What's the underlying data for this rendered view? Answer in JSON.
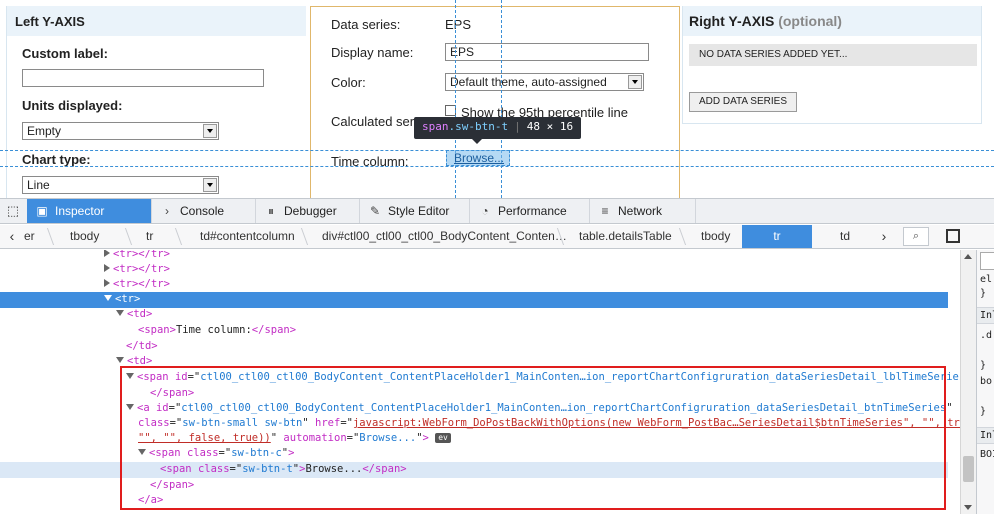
{
  "left_panel": {
    "title": "Left Y-AXIS",
    "custom_label": "Custom label:",
    "custom_label_value": "",
    "units_label": "Units displayed:",
    "units_value": "Empty",
    "chart_type_label": "Chart type:",
    "chart_type_value": "Line"
  },
  "mid_panel": {
    "data_series_label": "Data series:",
    "data_series_value": "EPS",
    "display_name_label": "Display name:",
    "display_name_value": "EPS",
    "color_label": "Color:",
    "color_value": "Default theme, auto-assigned",
    "calculated_label": "Calculated ser",
    "percentile_label": "Show the 95th percentile line",
    "time_column_label": "Time column:",
    "browse_label": "Browse..."
  },
  "right_panel": {
    "title": "Right Y-AXIS",
    "optional": "(optional)",
    "no_data": "NO DATA SERIES ADDED YET...",
    "add_button": "ADD DATA SERIES"
  },
  "tooltip": {
    "tag": "span",
    "class": ".sw-btn-t",
    "size": "48 × 16"
  },
  "devtools": {
    "tabs": [
      {
        "label": "Inspector",
        "icon": "inspector-icon"
      },
      {
        "label": "Console",
        "icon": "console-icon"
      },
      {
        "label": "Debugger",
        "icon": "debugger-icon"
      },
      {
        "label": "Style Editor",
        "icon": "style-editor-icon"
      },
      {
        "label": "Performance",
        "icon": "performance-icon"
      },
      {
        "label": "Network",
        "icon": "network-icon"
      }
    ],
    "breadcrumbs": [
      "er",
      "tbody",
      "tr",
      "td#contentcolumn",
      "div#ctl00_ctl00_ctl00_BodyContent_Conten…",
      "table.detailsTable",
      "tbody",
      "tr",
      "td"
    ],
    "markup": {
      "tr": "<tr>",
      "tr_close": "</tr>",
      "td_open": "<td>",
      "td_close": "</td>",
      "span_open": "<span>",
      "time_col_text": "Time column:",
      "span_close": "</span>",
      "span_id_attr": "id",
      "span_id_val": "ctl00_ctl00_ctl00_BodyContent_ContentPlaceHolder1_MainConten…ion_reportChartConfigruration_dataSeriesDetail_lblTimeSeries",
      "a_id_val": "ctl00_ctl00_ctl00_BodyContent_ContentPlaceHolder1_MainConten…ion_reportChartConfigruration_dataSeriesDetail_btnTimeSeries",
      "class_attr": "class",
      "a_class_val": "sw-btn-small sw-btn",
      "href_attr": "href",
      "href_val": "javascript:WebForm_DoPostBackWithOptions(new WebForm_PostBac…SeriesDetail$btnTimeSeries\", \"\", true,",
      "href_val_2": "\"\", \"\", false, true))",
      "automation_attr": "automation",
      "automation_val": "Browse...",
      "ev": "ev",
      "span_c_class": "sw-btn-c",
      "span_t_class": "sw-btn-t",
      "browse_text": "Browse...",
      "a_close": "</a>"
    },
    "side": [
      "el",
      "}",
      "Inl",
      ".d",
      "}",
      "bo",
      "}",
      "Inl",
      "BOI"
    ]
  }
}
